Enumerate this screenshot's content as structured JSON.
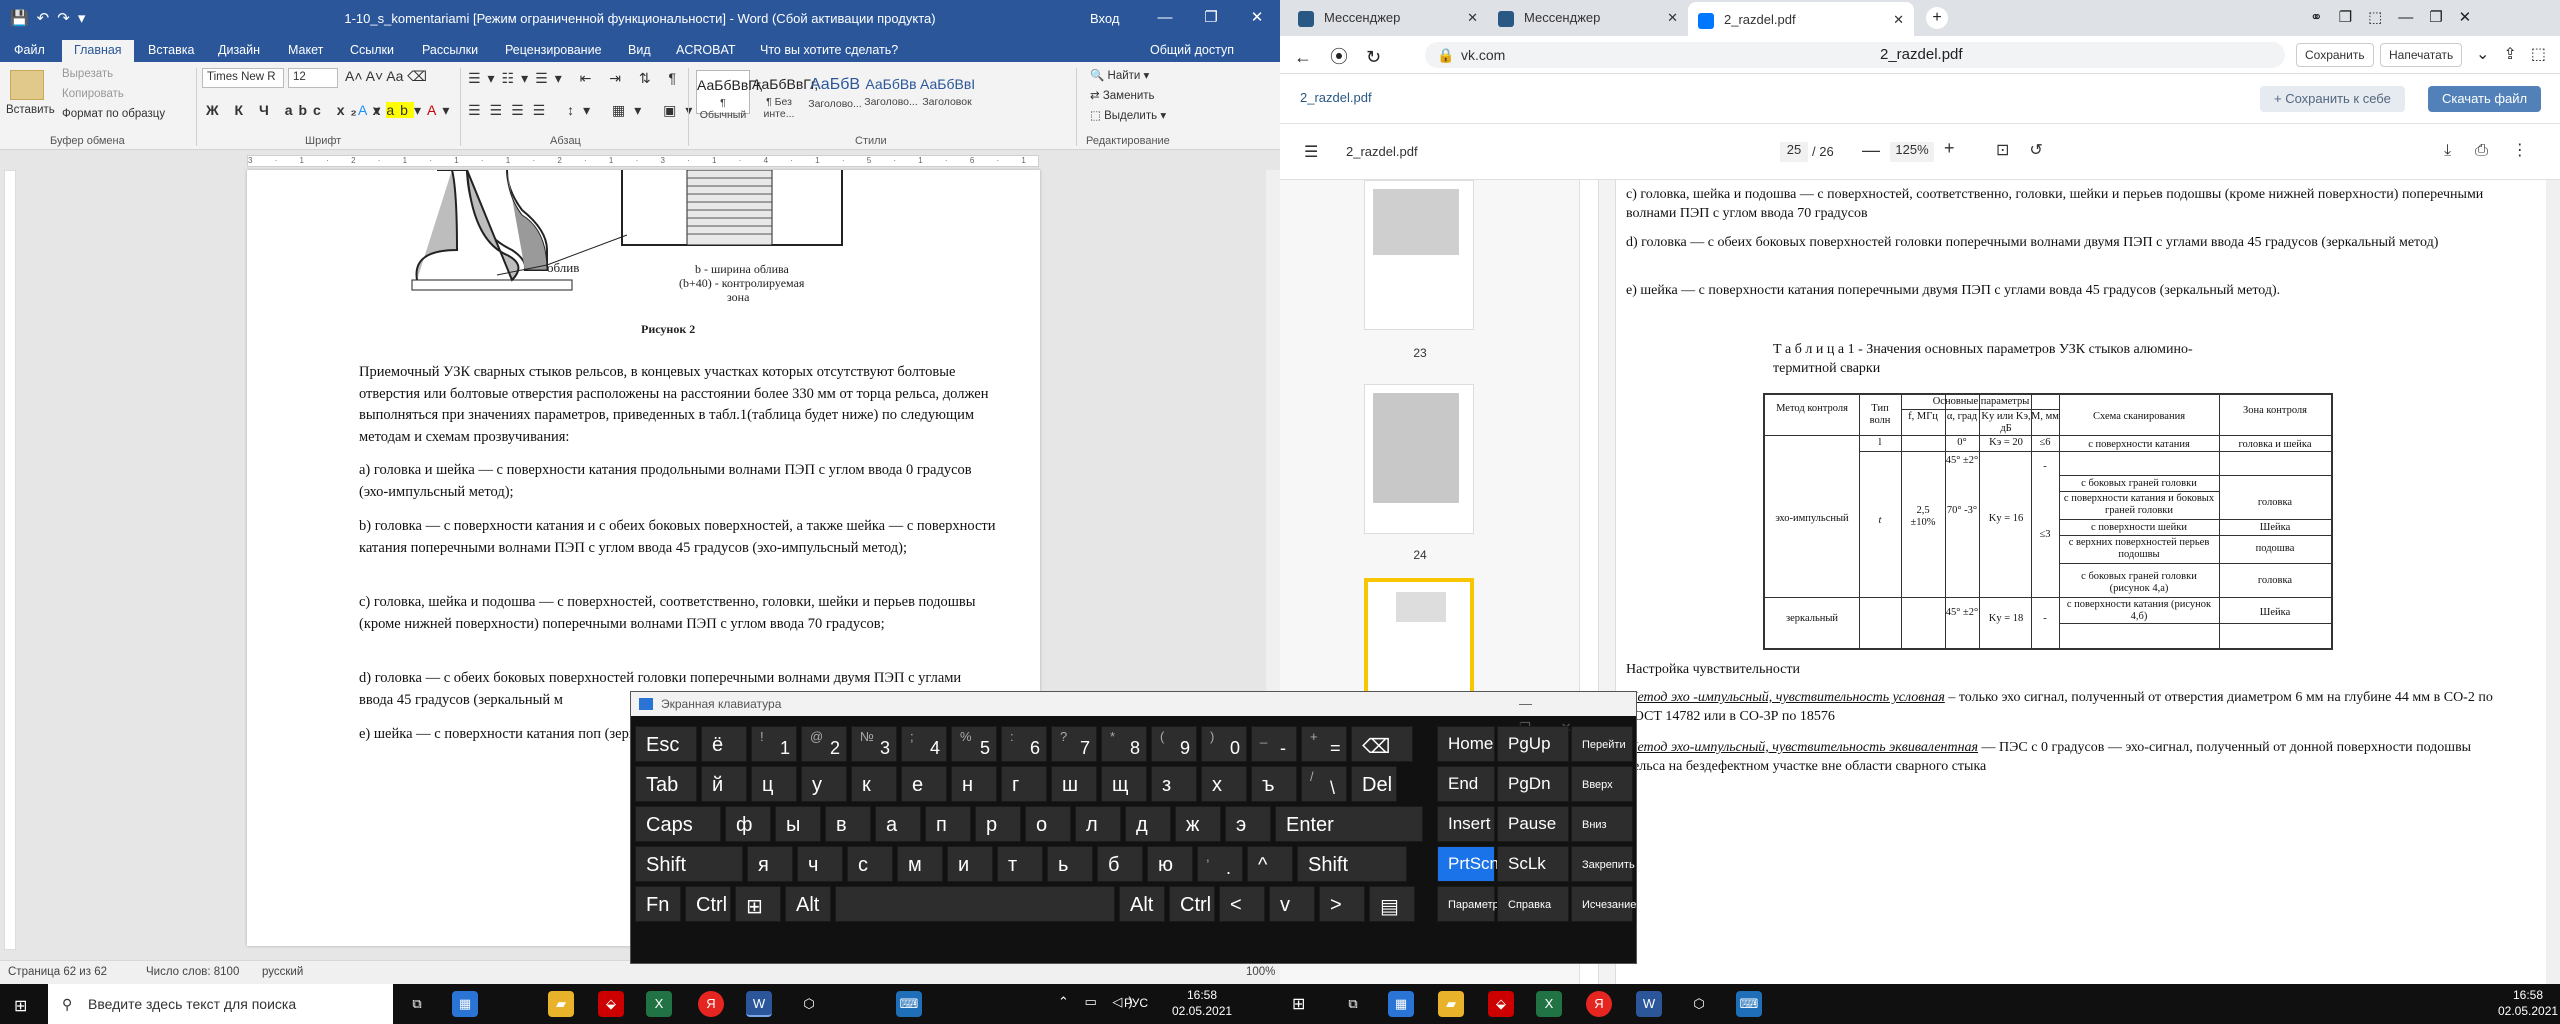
{
  "word": {
    "title": "1-10_s_komentariami [Режим ограниченной функциональности] - Word (Сбой активации продукта)",
    "login": "Вход",
    "share": "Общий доступ",
    "tabs": [
      "Файл",
      "Главная",
      "Вставка",
      "Дизайн",
      "Макет",
      "Ссылки",
      "Рассылки",
      "Рецензирование",
      "Вид",
      "ACROBAT",
      "Что вы хотите сделать?"
    ],
    "ribbon": {
      "paste": "Вставить",
      "cut": "Вырезать",
      "copy": "Копировать",
      "format_painter": "Формат по образцу",
      "font_name": "Times New R",
      "font_size": "12",
      "styles": [
        {
          "preview": "АаБбВвГг,",
          "name": "¶ Обычный"
        },
        {
          "preview": "АаБбВвГг,",
          "name": "¶ Без инте..."
        },
        {
          "preview": "АаБбВ",
          "name": "Заголово..."
        },
        {
          "preview": "АаБбВв",
          "name": "Заголово..."
        },
        {
          "preview": "АаБбВвI",
          "name": "Заголовок"
        }
      ],
      "find": "Найти",
      "replace": "Заменить",
      "select": "Выделить",
      "groups": [
        "Буфер обмена",
        "Шрифт",
        "Абзац",
        "Стили",
        "Редактирование"
      ]
    },
    "ruler": "3 · 1 · 2 · 1 · 1 · 1 · 2 · 1 · 3 · 1 · 4 · 1 · 5 · 1 · 6 · 1 · 7 · 1 · 8 · 1 · 9 · 1 · 10 · 1 · 11 · 1 · 12 · 1 · 13 · 1 · 14 · 1 · 15 · 1 · 16 · 1 · 17",
    "figure": {
      "label1": "b - ширина облива",
      "label2": "(b+40) - контролируемая",
      "label3": "зона",
      "weld": "облив",
      "caption": "Рисунок 2"
    },
    "paragraphs": [
      "Приемочный УЗК сварных стыков рельсов, в концевых участках которых отсутствуют болтовые отверстия или болтовые отверстия расположены на расстоянии более 330 мм от торца рельса, должен выполняться при значениях параметров, приведенных в табл.1(таблица будет ниже) по следующим методам и схемам прозвучивания:",
      "а) головка и шейка — с поверхности катания продольными волнами ПЭП с углом ввода 0 градусов (эхо-импульсный метод);",
      "b) головка — с поверхности катания и с обеих боковых поверхностей, а также шейка — с поверхности катания поперечными волнами ПЭП с углом ввода 45 градусов (эхо-импульсный метод);",
      "с) головка, шейка и подошва — с поверхностей, соответственно, головки, шейки и перьев подошвы (кроме нижней поверхности) поперечными волнами ПЭП с углом ввода 70 градусов;",
      "d) головка — с обеих боковых поверхностей головки поперечными волнами двумя ПЭП с углами ввода 45 градусов (зеркальный м",
      "е) шейка — с поверхности катания поп (зеркальный метод)."
    ],
    "status": {
      "page": "Страница 62 из 62",
      "words": "Число слов: 8100",
      "lang": "русский",
      "zoom": "100%"
    }
  },
  "browser": {
    "tabs": [
      {
        "title": "Мессенджер",
        "color": "#2a5885"
      },
      {
        "title": "Мессенджер",
        "color": "#2a5885"
      },
      {
        "title": "2_razdel.pdf",
        "color": "#0077ff"
      }
    ],
    "url": "vk.com",
    "page_title": "2_razdel.pdf",
    "save": "Сохранить",
    "print": "Напечатать",
    "vk_file": "2_razdel.pdf",
    "save_to_me": "+ Сохранить к себе",
    "download": "Скачать файл",
    "pdf": {
      "name": "2_razdel.pdf",
      "page": "25",
      "total": "/ 26",
      "zoom": "125%"
    },
    "thumbs": [
      "23",
      "24"
    ],
    "text": {
      "c": "с)           головка, шейка и подошва — с поверхностей, соответственно, головки, шейки и перьев подошвы (кроме нижней поверхности) поперечными волнами ПЭП с углом ввода 70 градусов",
      "d": "d)           головка — с обеих боковых поверхностей головки поперечными волнами двумя ПЭП с углами ввода 45 градусов (зеркальный метод)",
      "e": "е)           шейка — с поверхности катания поперечными двумя ПЭП с углами вовда 45 градусов (зеркальный метод).",
      "table_title1": "Т а б л и ц а 1 -  Значения основных параметров УЗК стыков    алюмино-",
      "table_title2": "термитной сварки",
      "sens": "Настройка чувствительности",
      "m1_label": "Метод эхо -импульсный, чувствительность условная",
      "m1_text": " – только эхо сигнал, полученный от отверстия диаметром 6 мм на глубине 44 мм в СО-2 по ГОСТ 14782 или в СО-3Р по 18576",
      "m2_label": "Метод эхо-импульсный, чувствительность эквивалентная",
      "m2_text": " — ПЭС с 0 градусов — эхо-сигнал, полученный от донной поверхности подошвы рельса на бездефектном участке вне области сварного стыка"
    },
    "table": {
      "h_method": "Метод контроля",
      "h_type": "Тип волн",
      "h_main": "Основные параметры",
      "h_f": "f, МГц",
      "h_a": "α, град",
      "h_k": "Kу или Kэ, дБ",
      "h_m": "M, мм",
      "h_scheme": "Схема сканирования",
      "h_zone": "Зона контроля",
      "t_l": "l",
      "t_t": "t",
      "f": "2,5 ±10%",
      "a0": "0°",
      "a45": "45° ±2°",
      "a70": "70° -3°",
      "a45b": "45° ±2°",
      "k0": "Kэ = 20",
      "k16": "Kу = 16",
      "k18": "Kу = 18",
      "m6": "≤6",
      "m3": "≤3",
      "dash1": "-",
      "dash2": "-",
      "echo": "эхо-импульсный",
      "mirror": "зеркальный",
      "s1": "с поверхности катания",
      "s2": "с боковых граней головки",
      "s3": "с поверхности катания и боковых граней головки",
      "s4": "с поверхности шейки",
      "s5": "с верхних поверхностей перьев подошвы",
      "s6": "с боковых граней головки (рисунок 4,а)",
      "s7": "с поверхности катания (рисунок 4,б)",
      "z1": "головка и шейка",
      "z2": "головка",
      "z3": "Шейка",
      "z4": "подошва",
      "z5": "головка",
      "z6": "Шейка"
    }
  },
  "osk": {
    "title": "Экранная клавиатура",
    "row1": [
      {
        "k": "Esc"
      },
      {
        "k": "ё"
      },
      {
        "t": "!",
        "k": "1"
      },
      {
        "t": "@",
        "k": "2"
      },
      {
        "t": "№",
        "k": "3"
      },
      {
        "t": ";",
        "k": "4"
      },
      {
        "t": "%",
        "k": "5"
      },
      {
        "t": ":",
        "k": "6"
      },
      {
        "t": "?",
        "k": "7"
      },
      {
        "t": "*",
        "k": "8"
      },
      {
        "t": "(",
        "k": "9"
      },
      {
        "t": ")",
        "k": "0"
      },
      {
        "t": "_",
        "k": "-"
      },
      {
        "t": "+",
        "k": "="
      },
      {
        "k": "⌫"
      }
    ],
    "row2": [
      {
        "k": "Tab"
      },
      {
        "k": "й"
      },
      {
        "k": "ц"
      },
      {
        "k": "у"
      },
      {
        "k": "к"
      },
      {
        "k": "е"
      },
      {
        "k": "н"
      },
      {
        "k": "г"
      },
      {
        "k": "ш"
      },
      {
        "k": "щ"
      },
      {
        "k": "з"
      },
      {
        "k": "х"
      },
      {
        "k": "ъ"
      },
      {
        "t": "/",
        "k": "\\"
      },
      {
        "k": "Del"
      }
    ],
    "row3": [
      {
        "k": "Caps"
      },
      {
        "k": "ф"
      },
      {
        "k": "ы"
      },
      {
        "k": "в"
      },
      {
        "k": "а"
      },
      {
        "k": "п"
      },
      {
        "k": "р"
      },
      {
        "k": "о"
      },
      {
        "k": "л"
      },
      {
        "k": "д"
      },
      {
        "k": "ж"
      },
      {
        "k": "э"
      },
      {
        "k": "Enter"
      }
    ],
    "row4": [
      {
        "k": "Shift"
      },
      {
        "k": "я"
      },
      {
        "k": "ч"
      },
      {
        "k": "с"
      },
      {
        "k": "м"
      },
      {
        "k": "и"
      },
      {
        "k": "т"
      },
      {
        "k": "ь"
      },
      {
        "k": "б"
      },
      {
        "k": "ю"
      },
      {
        "t": ",",
        "k": "."
      },
      {
        "k": "^"
      },
      {
        "k": "Shift"
      }
    ],
    "row5": [
      {
        "k": "Fn"
      },
      {
        "k": "Ctrl"
      },
      {
        "k": "⊞"
      },
      {
        "k": "Alt"
      },
      {
        "k": ""
      },
      {
        "k": "Alt"
      },
      {
        "k": "Ctrl"
      },
      {
        "k": "<"
      },
      {
        "k": "v"
      },
      {
        "k": ">"
      },
      {
        "k": "▤"
      }
    ],
    "nav": [
      [
        "Home",
        "PgUp",
        "Перейти"
      ],
      [
        "End",
        "PgDn",
        "Вверх"
      ],
      [
        "Insert",
        "Pause",
        "Вниз"
      ],
      [
        "PrtScn",
        "ScLk",
        "Закрепить"
      ],
      [
        "Параметры",
        "Справка",
        "Исчезание"
      ]
    ]
  },
  "taskbar": {
    "search": "Введите здесь текст для поиска",
    "lang": "РУС",
    "time": "16:58",
    "date": "02.05.2021"
  }
}
